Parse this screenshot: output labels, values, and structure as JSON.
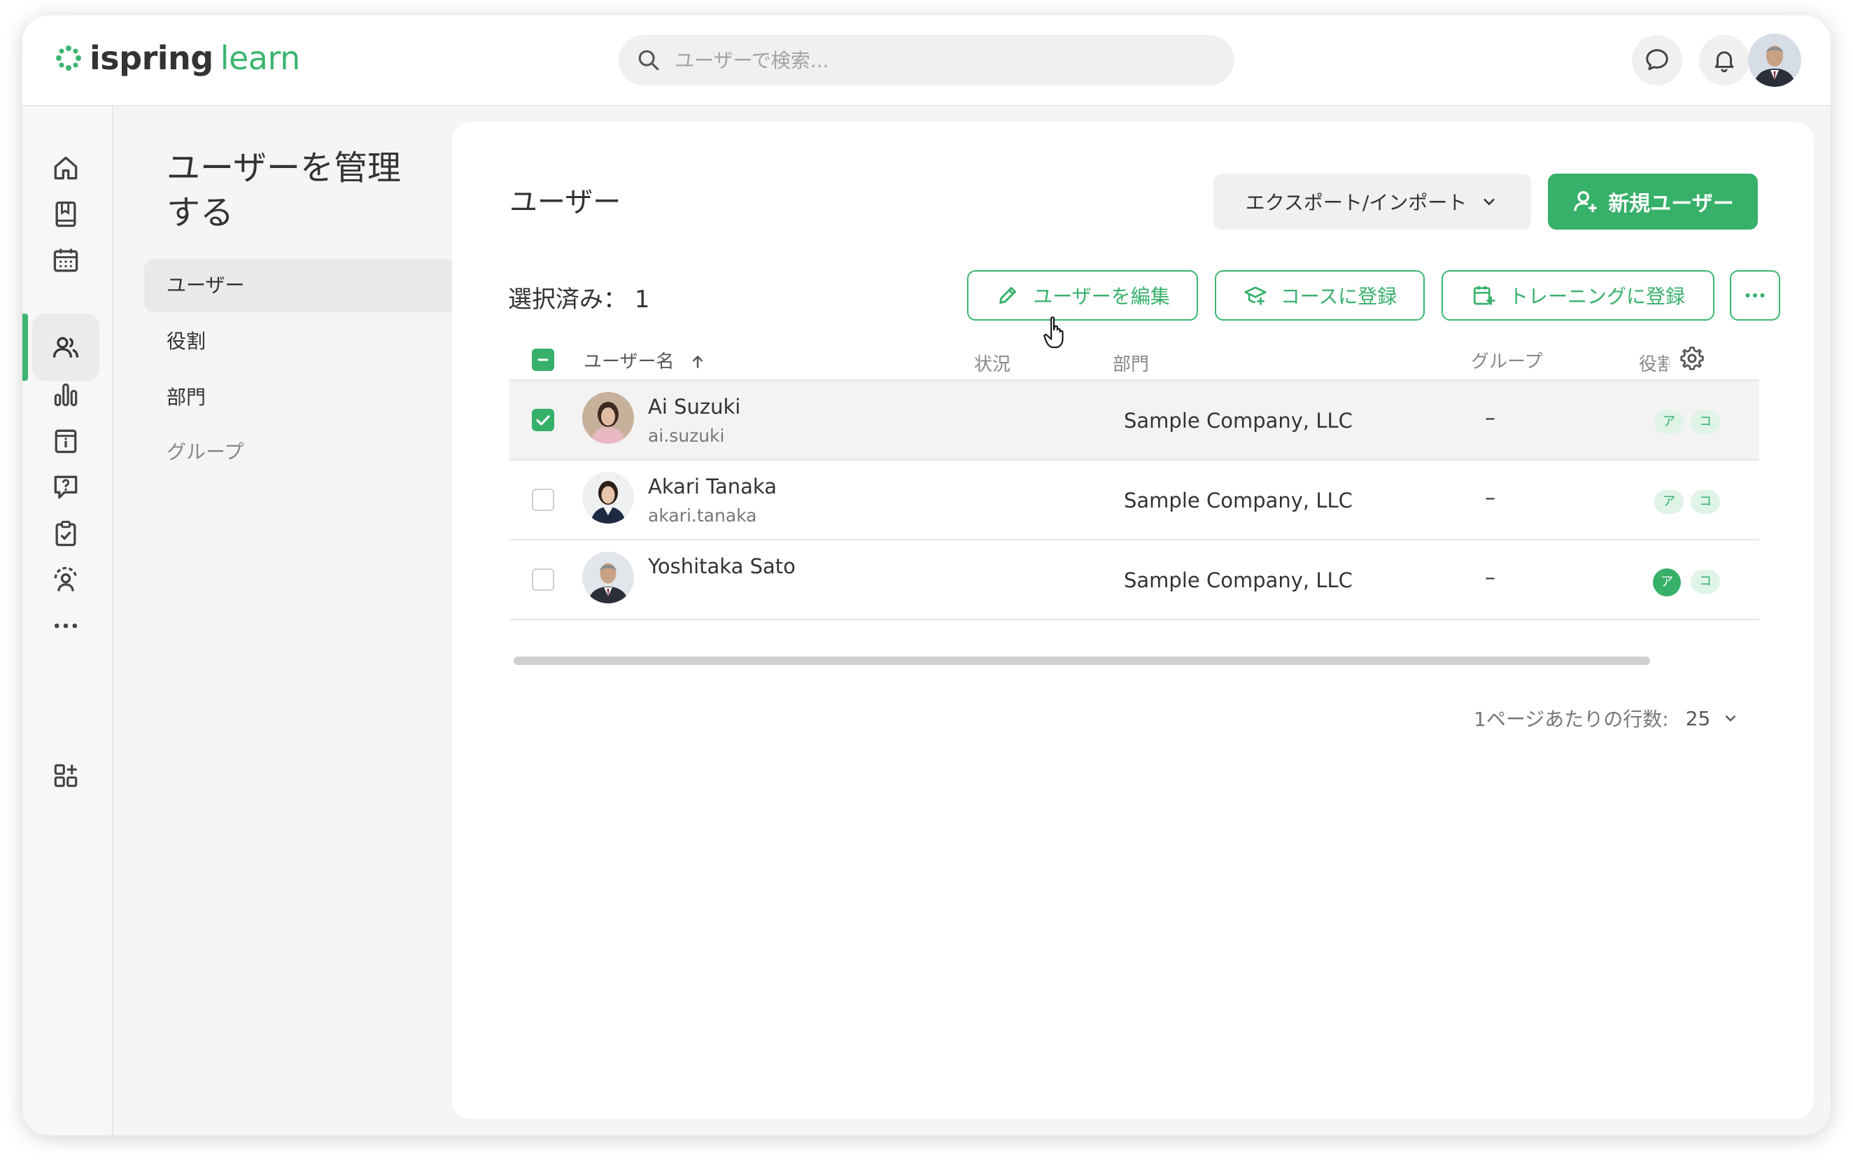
{
  "brand": {
    "name_bold": "ispring",
    "name_light": "learn",
    "accent": "#3cb56f"
  },
  "search": {
    "placeholder": "ユーザーで検索..."
  },
  "header": {
    "icons": [
      "chat-icon",
      "bell-icon",
      "profile-avatar"
    ]
  },
  "rail": {
    "items": [
      "home-icon",
      "book-icon",
      "calendar-icon",
      "users-icon",
      "reports-icon",
      "info-icon",
      "question-icon",
      "clipboard-icon",
      "support-icon",
      "more-icon",
      "apps-icon"
    ],
    "active": "users-icon"
  },
  "subnav": {
    "title": "ユーザーを管理する",
    "items": [
      {
        "label": "ユーザー",
        "active": true
      },
      {
        "label": "役割"
      },
      {
        "label": "部門"
      },
      {
        "label": "グループ"
      }
    ]
  },
  "main": {
    "title": "ユーザー",
    "export_label": "エクスポート/インポート",
    "new_user_label": "新規ユーザー",
    "selected_label": "選択済み：",
    "selected_count": "1",
    "actions": {
      "edit": "ユーザーを編集",
      "enroll_course": "コースに登録",
      "enroll_training": "トレーニングに登録"
    },
    "columns": {
      "name": "ユーザー名",
      "status": "状況",
      "dept": "部門",
      "group": "グループ",
      "role": "役割"
    },
    "rows": [
      {
        "name": "Ai Suzuki",
        "login": "ai.suzuki",
        "dept": "Sample Company, LLC",
        "group": "–",
        "role_a": "ア",
        "role_b": "コ",
        "selected": true
      },
      {
        "name": "Akari Tanaka",
        "login": "akari.tanaka",
        "dept": "Sample Company, LLC",
        "group": "–",
        "role_a": "ア",
        "role_b": "コ",
        "selected": false
      },
      {
        "name": "Yoshitaka Sato",
        "login": "",
        "dept": "Sample Company, LLC",
        "group": "–",
        "role_a": "ア",
        "role_b": "コ",
        "selected": false
      }
    ],
    "rows_per_page_label": "1ページあたりの行数:",
    "rows_per_page_value": "25"
  }
}
